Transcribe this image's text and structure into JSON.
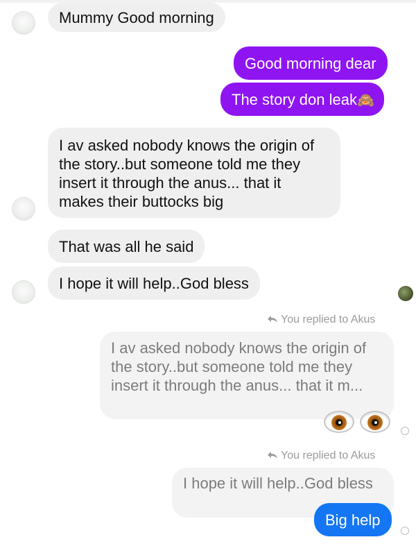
{
  "messages": {
    "m1": "Mummy Good morning",
    "m2": "Good morning dear",
    "m3_text": "The story don leak",
    "m3_emoji": "🙈",
    "m4": "I av asked nobody knows the origin of the story..but someone told me they insert it through the anus... that it makes their buttocks big",
    "m5": "That was all he said",
    "m6": "I hope it will help..God bless",
    "reply1_note": "You replied to Akus",
    "reply1_quote": "I av asked nobody knows the origin of the story..but someone told me they insert it through the anus... that it m...",
    "reply1_emoji": "👀",
    "reply2_note": "You replied to Akus",
    "reply2_quote": "I hope it will help..God bless",
    "reply2_text": "Big help"
  },
  "icons": {
    "reply_icon": "reply-arrow-icon",
    "eyes_icon": "eyes-emoji-icon",
    "monkey_icon": "see-no-evil-monkey-icon"
  },
  "colors": {
    "outgoing_purple": "#8f14f2",
    "outgoing_blue": "#1476f2",
    "incoming_bg": "#efefef",
    "quote_bg": "#f3f3f3",
    "meta_gray": "#9a9a9a"
  }
}
